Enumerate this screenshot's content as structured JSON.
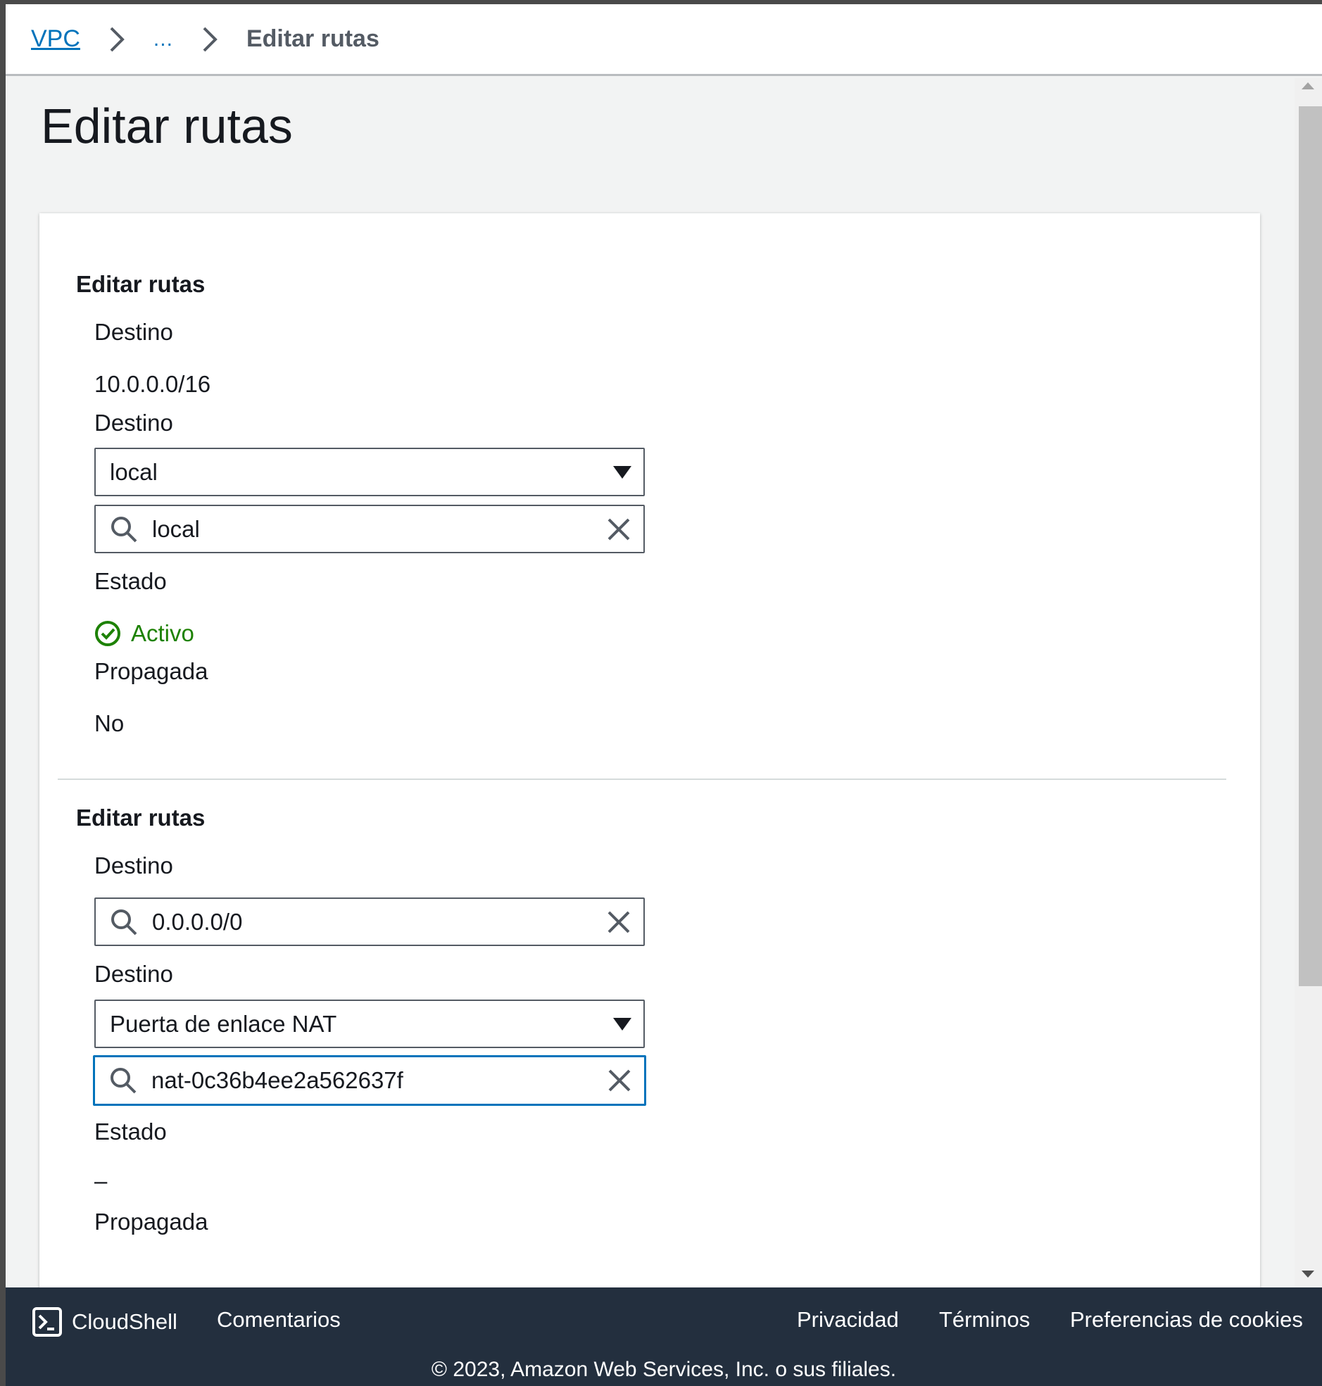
{
  "breadcrumb": {
    "root": "VPC",
    "ellipsis": "...",
    "current": "Editar rutas"
  },
  "page": {
    "title": "Editar rutas"
  },
  "routes": [
    {
      "section_title": "Editar rutas",
      "destination_label": "Destino",
      "destination_value": "10.0.0.0/16",
      "target_label": "Destino",
      "target_type": "local",
      "target_search": "local",
      "status_label": "Estado",
      "status_value": "Activo",
      "propagated_label": "Propagada",
      "propagated_value": "No"
    },
    {
      "section_title": "Editar rutas",
      "destination_label": "Destino",
      "destination_search": "0.0.0.0/0",
      "target_label": "Destino",
      "target_type": "Puerta de enlace NAT",
      "target_search": "nat-0c36b4ee2a562637f",
      "status_label": "Estado",
      "status_value": "–",
      "propagated_label": "Propagada"
    }
  ],
  "footer": {
    "cloudshell": "CloudShell",
    "feedback": "Comentarios",
    "privacy": "Privacidad",
    "terms": "Términos",
    "cookies": "Preferencias de cookies",
    "copyright": "© 2023, Amazon Web Services, Inc. o sus filiales."
  },
  "colors": {
    "link": "#0073bb",
    "success": "#1d8102",
    "footer_bg": "#232f3e",
    "focus_border": "#0073bb"
  },
  "icons": {
    "breadcrumb_separator": "chevron-right-icon",
    "dropdown": "caret-down-icon",
    "search": "search-icon",
    "clear": "close-icon",
    "status_active": "check-circle-icon",
    "cloudshell": "terminal-icon"
  }
}
